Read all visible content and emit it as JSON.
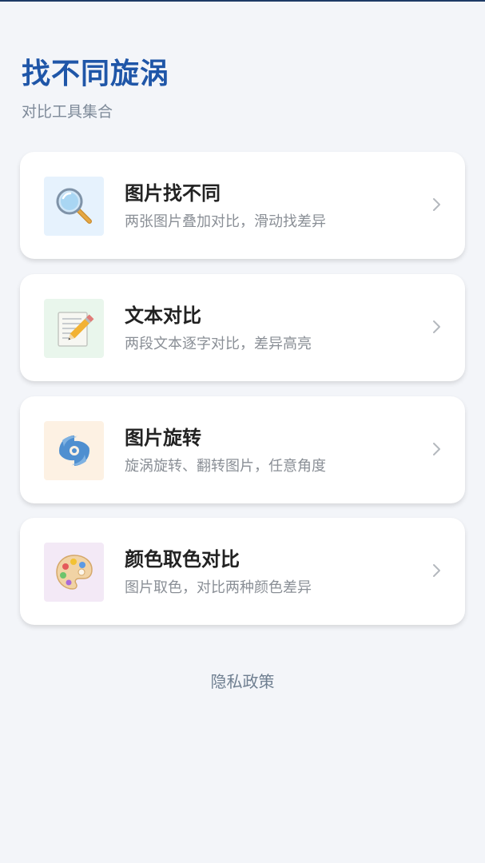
{
  "header": {
    "title": "找不同旋涡",
    "subtitle": "对比工具集合"
  },
  "cards": [
    {
      "title": "图片找不同",
      "description": "两张图片叠加对比，滑动找差异",
      "icon": "magnifier-icon",
      "icon_bg": "#e6f2fd"
    },
    {
      "title": "文本对比",
      "description": "两段文本逐字对比，差异高亮",
      "icon": "memo-pencil-icon",
      "icon_bg": "#e9f6ec"
    },
    {
      "title": "图片旋转",
      "description": "旋涡旋转、翻转图片，任意角度",
      "icon": "cyclone-icon",
      "icon_bg": "#fdf1e3"
    },
    {
      "title": "颜色取色对比",
      "description": "图片取色，对比两种颜色差异",
      "icon": "palette-icon",
      "icon_bg": "#f3e9f6"
    }
  ],
  "footer": {
    "privacy_link": "隐私政策"
  },
  "colors": {
    "background": "#f3f5f9",
    "title": "#1f56a8",
    "card": "#ffffff"
  }
}
